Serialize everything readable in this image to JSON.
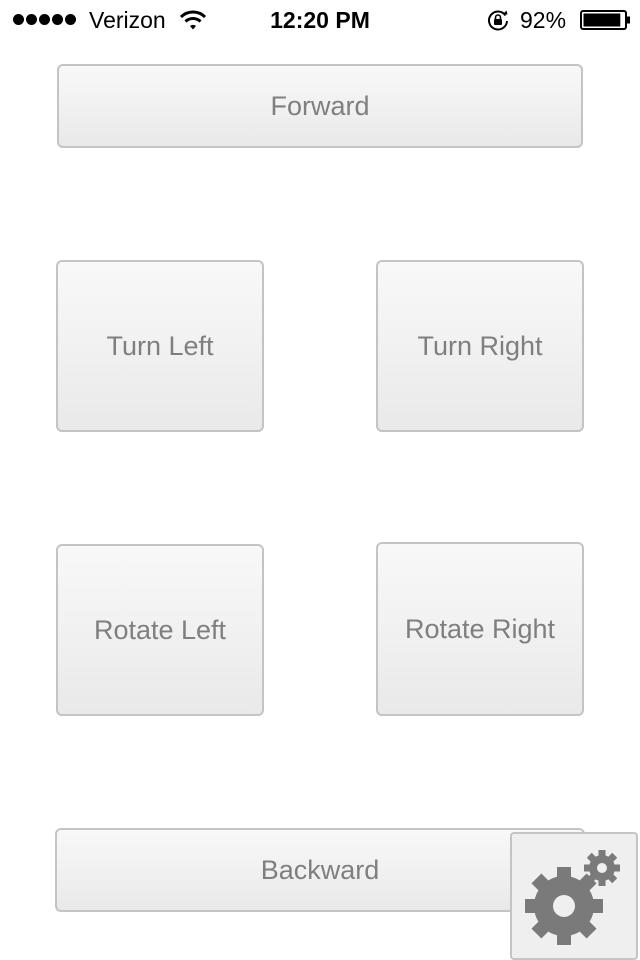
{
  "status_bar": {
    "carrier": "Verizon",
    "time": "12:20 PM",
    "battery_percent": "92%",
    "battery_level": 0.92,
    "signal_bars": 5,
    "icons": [
      "signal-dots-icon",
      "wifi-icon",
      "rotation-lock-icon",
      "battery-icon"
    ]
  },
  "controls": {
    "forward_label": "Forward",
    "turn_left_label": "Turn Left",
    "turn_right_label": "Turn Right",
    "rotate_left_label": "Rotate Left",
    "rotate_right_label": "Rotate Right",
    "backward_label": "Backward"
  },
  "settings": {
    "icon": "gears-icon"
  },
  "colors": {
    "button_text": "#7f7f7f",
    "button_border": "#c4c4c4",
    "gear": "#7a7a7a"
  }
}
